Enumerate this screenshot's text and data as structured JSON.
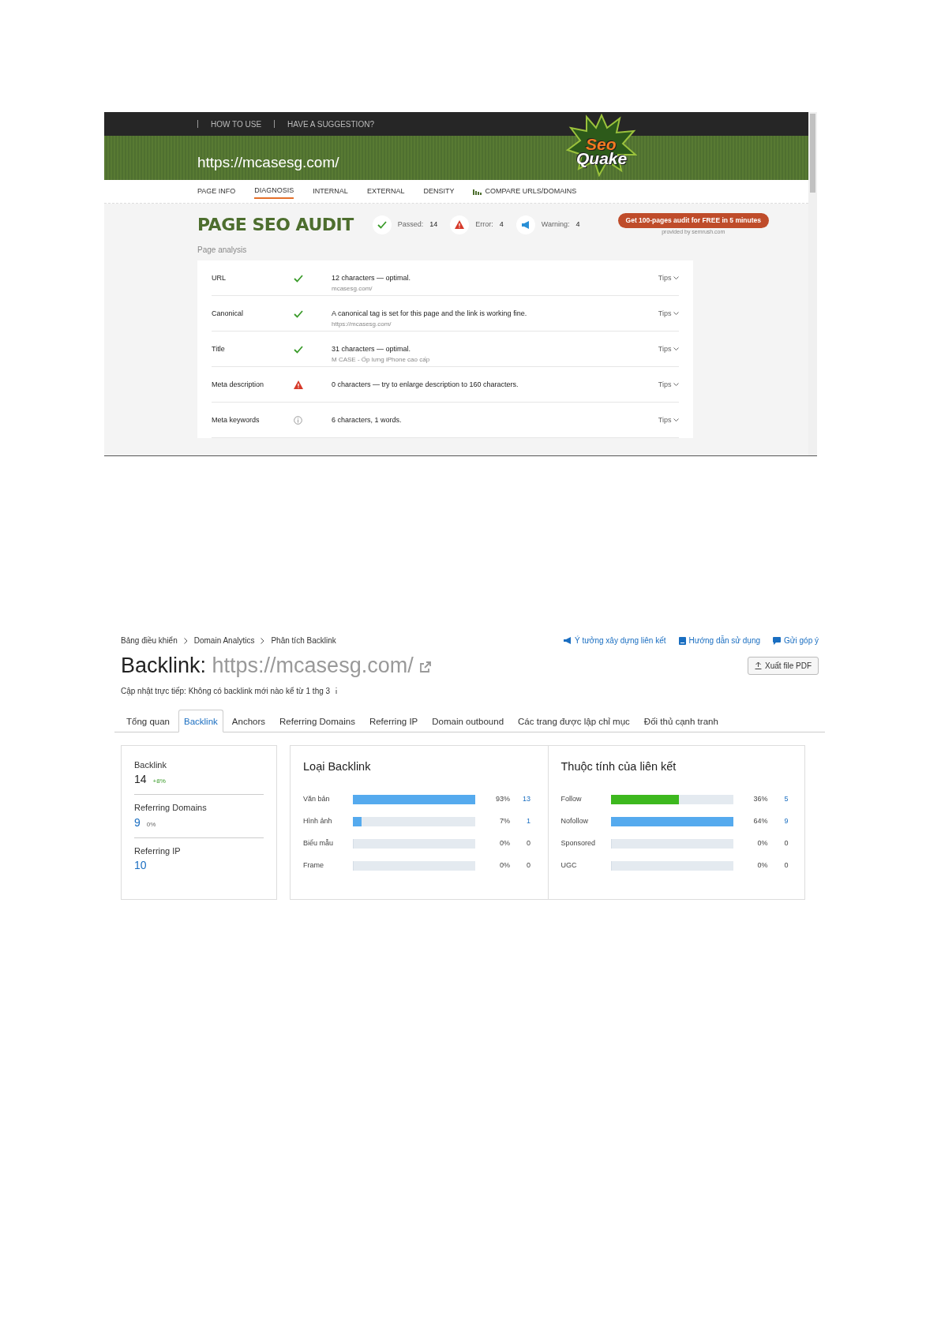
{
  "seoquake": {
    "top_links": [
      "HOW TO USE",
      "HAVE A SUGGESTION?"
    ],
    "logo": [
      "Seo",
      "Quake"
    ],
    "url": "https://mcasesg.com/",
    "tabs": [
      {
        "label": "PAGE INFO",
        "selected": false
      },
      {
        "label": "DIAGNOSIS",
        "selected": true
      },
      {
        "label": "INTERNAL",
        "selected": false
      },
      {
        "label": "EXTERNAL",
        "selected": false
      },
      {
        "label": "DENSITY",
        "selected": false
      },
      {
        "label": "COMPARE URLS/DOMAINS",
        "selected": false,
        "kind": "chart"
      }
    ],
    "heading": "PAGE SEO AUDIT",
    "stats": [
      {
        "kind": "passed",
        "label": "Passed:",
        "value": "14"
      },
      {
        "kind": "error",
        "label": "Error:",
        "value": "4"
      },
      {
        "kind": "warning",
        "label": "Warning:",
        "value": "4"
      }
    ],
    "promo": {
      "button": "Get 100-pages audit for FREE in 5 minutes",
      "note": "provided by  semrush.com"
    },
    "section": "Page analysis",
    "rows": [
      {
        "name": "URL",
        "kind": "ok",
        "text": "12 characters — optimal.",
        "sub": "mcasesg.com/",
        "tips": "Tips"
      },
      {
        "name": "Canonical",
        "kind": "ok",
        "text": "A canonical tag is set for this page and the link is working fine.",
        "sub": "https://mcasesg.com/",
        "tips": "Tips"
      },
      {
        "name": "Title",
        "kind": "ok",
        "text": "31 characters — optimal.",
        "sub": "M CASE - Ốp lưng iPhone cao cấp",
        "tips": "Tips"
      },
      {
        "name": "Meta description",
        "kind": "error",
        "text": "0 characters — try to enlarge description to 160 characters.",
        "tips": "Tips"
      },
      {
        "name": "Meta keywords",
        "kind": "info",
        "text": "6 characters, 1 words.",
        "tips": "Tips"
      }
    ]
  },
  "semrush": {
    "breadcrumbs": [
      "Bảng điều khiển",
      "Domain Analytics",
      "Phân tích Backlink"
    ],
    "links": [
      {
        "kind": "idea",
        "label": "Ý tưởng xây dựng liên kết"
      },
      {
        "kind": "guide",
        "label": "Hướng dẫn sử dụng"
      },
      {
        "kind": "feedback",
        "label": "Gửi góp ý"
      }
    ],
    "title": "Backlink:",
    "domain": "https://mcasesg.com/",
    "export": "Xuất file PDF",
    "update": "Cập nhật trực tiếp: Không có backlink mới nào kể từ 1 thg 3",
    "tabs": [
      {
        "label": "Tổng quan",
        "selected": false
      },
      {
        "label": "Backlink",
        "selected": true
      },
      {
        "label": "Anchors",
        "selected": false
      },
      {
        "label": "Referring Domains",
        "selected": false
      },
      {
        "label": "Referring IP",
        "selected": false
      },
      {
        "label": "Domain outbound",
        "selected": false
      },
      {
        "label": "Các trang được lập chỉ mục",
        "selected": false
      },
      {
        "label": "Đối thủ cạnh tranh",
        "selected": false
      }
    ],
    "summary": [
      {
        "label": "Backlink",
        "value": "14",
        "change": "+8%",
        "kind": "rise"
      },
      {
        "label": "Referring Domains",
        "value": "9",
        "change": "0%",
        "kind": "flat"
      },
      {
        "label": "Referring IP",
        "value": "10"
      }
    ],
    "panels": [
      {
        "title": "Loại Backlink",
        "bars": [
          {
            "label": "Văn bản",
            "level": 1.0,
            "color": "#55aaee",
            "pct": "93%",
            "count": "13"
          },
          {
            "label": "Hình ảnh",
            "level": 0.07,
            "color": "#55aaee",
            "pct": "7%",
            "count": "1"
          },
          {
            "label": "Biểu mẫu",
            "level": 0,
            "pct": "0%",
            "count": "0"
          },
          {
            "label": "Frame",
            "level": 0,
            "pct": "0%",
            "count": "0"
          }
        ]
      },
      {
        "title": "Thuộc tính của liên kết",
        "bars": [
          {
            "label": "Follow",
            "level": 0.56,
            "color": "#3db81e",
            "pct": "36%",
            "count": "5"
          },
          {
            "label": "Nofollow",
            "level": 1.0,
            "color": "#55aaee",
            "pct": "64%",
            "count": "9"
          },
          {
            "label": "Sponsored",
            "level": 0,
            "pct": "0%",
            "count": "0"
          },
          {
            "label": "UGC",
            "level": 0,
            "pct": "0%",
            "count": "0"
          }
        ]
      }
    ]
  }
}
